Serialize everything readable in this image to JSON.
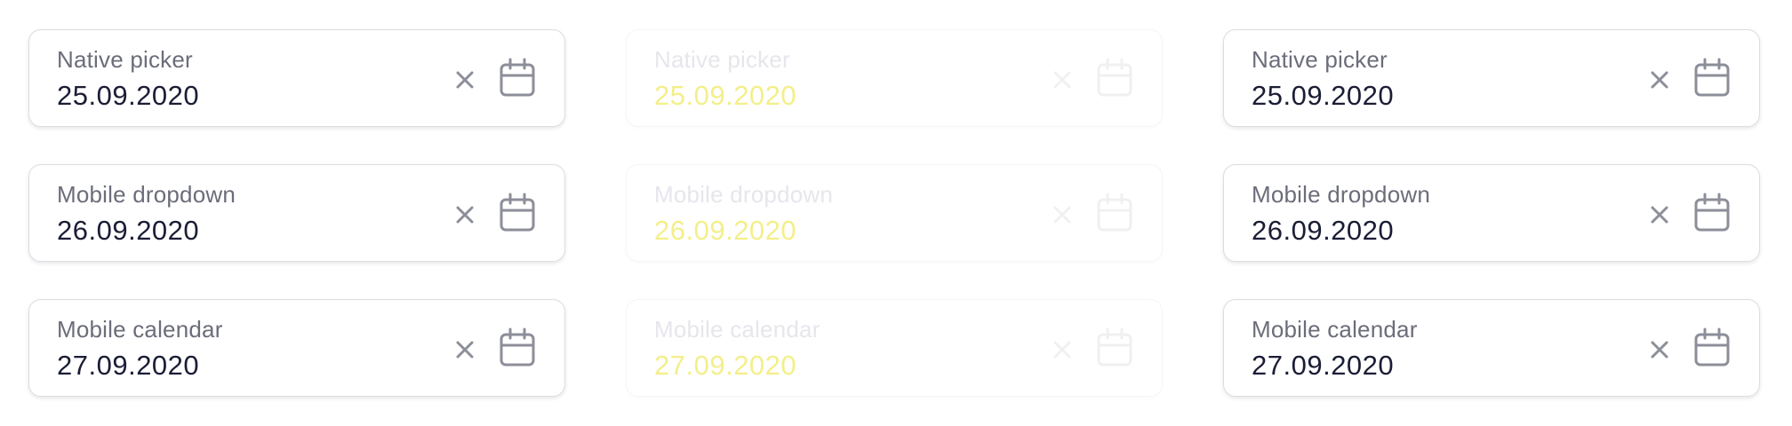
{
  "colors": {
    "label": "#6b6d7a",
    "value": "#1b1d36",
    "icon": "#8c8e99",
    "border": "#dcdde3",
    "faded_value": "#f3ef8a"
  },
  "icons": {
    "clear": "close-icon",
    "calendar": "calendar-icon"
  },
  "columns": [
    {
      "fields": [
        {
          "label": "Native picker",
          "value": "25.09.2020"
        },
        {
          "label": "Mobile dropdown",
          "value": "26.09.2020"
        },
        {
          "label": "Mobile calendar",
          "value": "27.09.2020"
        }
      ]
    },
    {
      "fields": [
        {
          "label": "Native picker",
          "value": "25.09.2020"
        },
        {
          "label": "Mobile dropdown",
          "value": "26.09.2020"
        },
        {
          "label": "Mobile calendar",
          "value": "27.09.2020"
        }
      ]
    },
    {
      "fields": [
        {
          "label": "Native picker",
          "value": "25.09.2020"
        },
        {
          "label": "Mobile dropdown",
          "value": "26.09.2020"
        },
        {
          "label": "Mobile calendar",
          "value": "27.09.2020"
        }
      ]
    }
  ]
}
